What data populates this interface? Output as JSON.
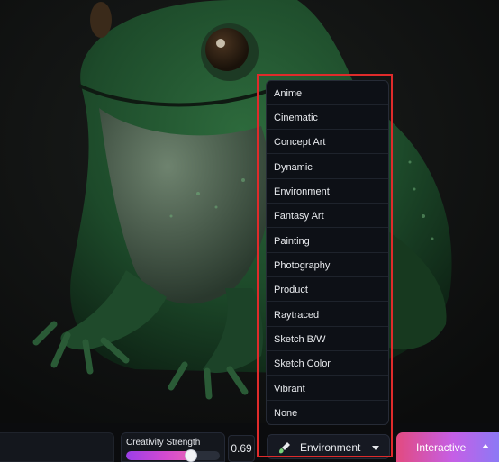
{
  "style_menu": {
    "items": [
      "Anime",
      "Cinematic",
      "Concept Art",
      "Dynamic",
      "Environment",
      "Fantasy Art",
      "Painting",
      "Photography",
      "Product",
      "Raytraced",
      "Sketch B/W",
      "Sketch Color",
      "Vibrant",
      "None"
    ],
    "selected": "Environment"
  },
  "toolbar": {
    "creativity_label": "Creativity Strength",
    "creativity_value": "0.69",
    "creativity_fraction": 0.69,
    "style_select_label": "Environment",
    "interactive_label": "Interactive"
  },
  "icons": {
    "style_select": "paintbrush-icon",
    "style_select_chevron": "chevron-down-icon",
    "interactive_chevron": "chevron-up-icon"
  },
  "colors": {
    "highlight": "#e02b2b",
    "slider_gradient_start": "#9b3ee8",
    "slider_gradient_end": "#e660b8",
    "button_gradient_start": "#e24a80",
    "button_gradient_end": "#8c79f5"
  }
}
